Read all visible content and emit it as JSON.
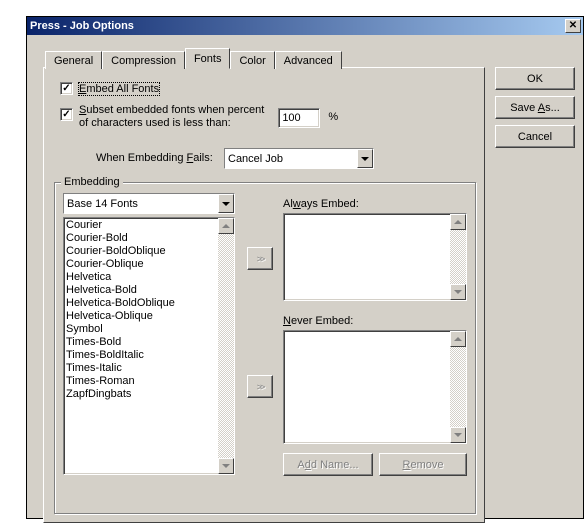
{
  "window": {
    "title": "Press - Job Options"
  },
  "buttons": {
    "ok": "OK",
    "save_as": "Save As...",
    "cancel": "Cancel"
  },
  "tabs": {
    "general": "General",
    "compression": "Compression",
    "fonts": "Fonts",
    "color": "Color",
    "advanced": "Advanced",
    "active": "fonts"
  },
  "embed_all": {
    "checked": true,
    "label": "Embed All Fonts"
  },
  "subset": {
    "checked": true,
    "label_pre": "Subset embedded fonts when percent",
    "label_post": "of characters used is less than:",
    "value": "100",
    "suffix": "%"
  },
  "when_fails": {
    "label": "When Embedding Fails:",
    "value": "Cancel Job"
  },
  "embedding_group": "Embedding",
  "font_source": {
    "value": "Base 14 Fonts"
  },
  "font_list": [
    "Courier",
    "Courier-Bold",
    "Courier-BoldOblique",
    "Courier-Oblique",
    "Helvetica",
    "Helvetica-Bold",
    "Helvetica-BoldOblique",
    "Helvetica-Oblique",
    "Symbol",
    "Times-Bold",
    "Times-BoldItalic",
    "Times-Italic",
    "Times-Roman",
    "ZapfDingbats"
  ],
  "always_embed_label": "Always Embed:",
  "never_embed_label": "Never Embed:",
  "add_name": "Add Name...",
  "remove": "Remove"
}
